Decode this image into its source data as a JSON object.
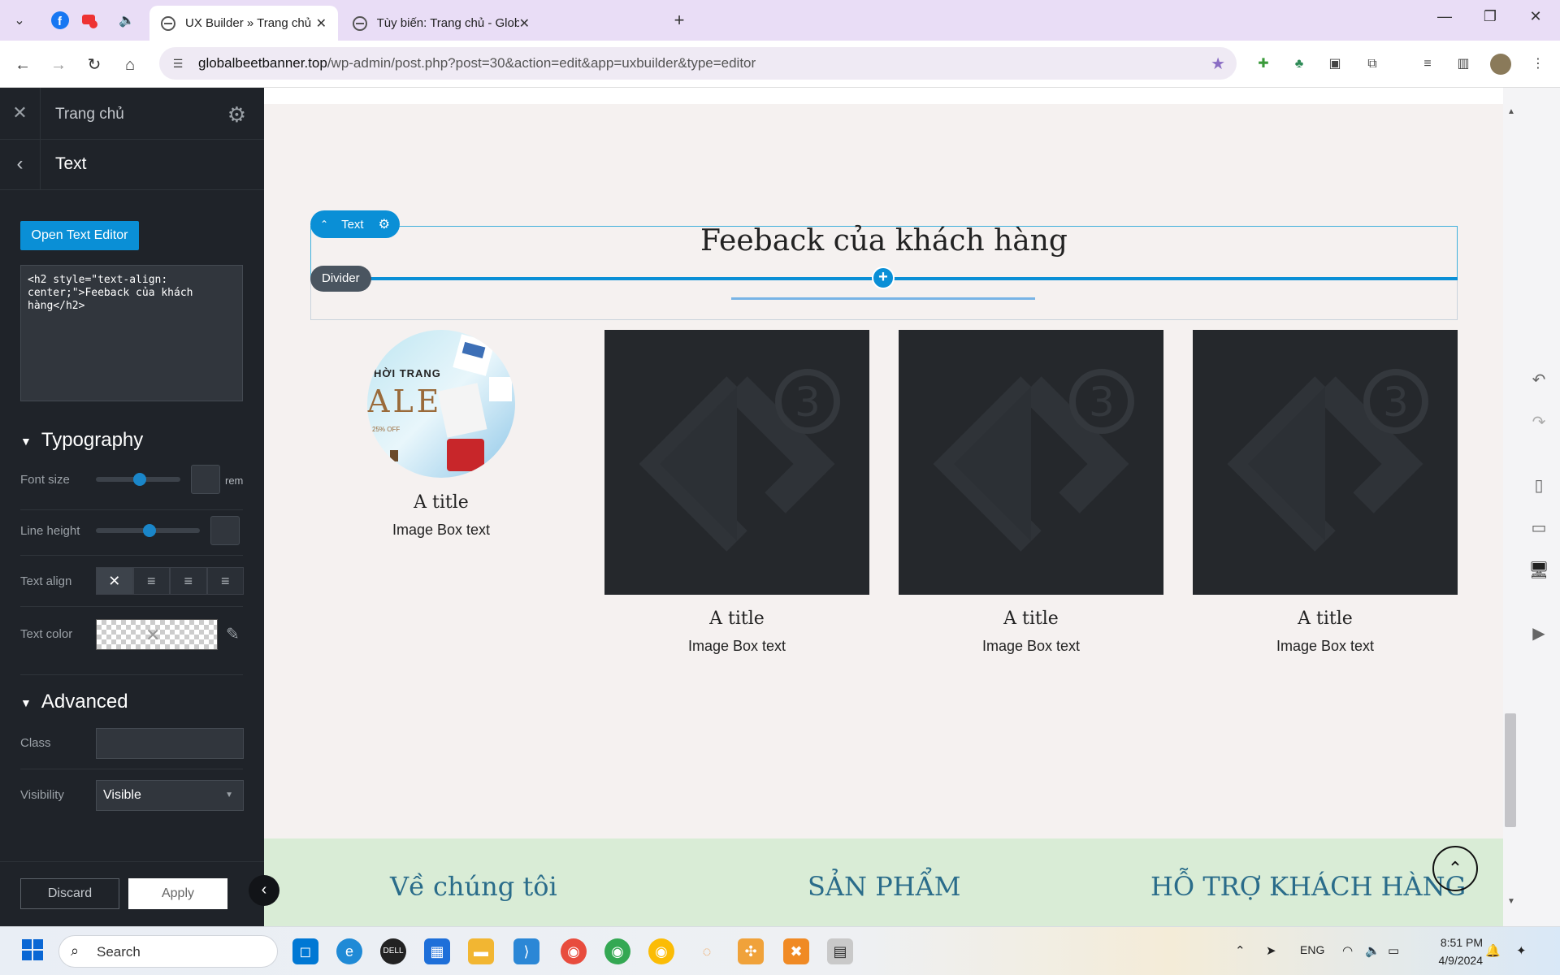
{
  "browser": {
    "tabs": [
      {
        "label": "UX Builder » Trang chủ",
        "active": true
      },
      {
        "label": "Tùy biến: Trang chủ - Global Be",
        "active": false
      }
    ],
    "url_host": "globalbeetbanner.top",
    "url_path": "/wp-admin/post.php?post=30&action=edit&app=uxbuilder&type=editor",
    "accent": "#8a6dc4"
  },
  "sidebar": {
    "page_title": "Trang chủ",
    "panel_title": "Text",
    "open_editor_label": "Open Text Editor",
    "html_source": "<h2 style=\"text-align:\ncenter;\">Feeback của khách\nhàng</h2>",
    "typography": {
      "heading": "Typography",
      "font_size_label": "Font size",
      "font_size_unit": "rem",
      "font_size_level": 0.5,
      "line_height_label": "Line height",
      "line_height_level": 0.5,
      "text_align_label": "Text align",
      "text_color_label": "Text color"
    },
    "advanced": {
      "heading": "Advanced",
      "class_label": "Class",
      "class_value": "",
      "visibility_label": "Visibility",
      "visibility_value": "Visible"
    },
    "discard_label": "Discard",
    "apply_label": "Apply",
    "accent": "#0a8fd6"
  },
  "canvas": {
    "heading": "Feeback của khách hàng",
    "text_tag": "Text",
    "divider_tag": "Divider",
    "round_image_lines": [
      "HỜI TRANG",
      "ALE",
      "25% OFF"
    ],
    "cards": [
      {
        "title": "A title",
        "text": "Image Box text"
      },
      {
        "title": "A title",
        "text": "Image Box text"
      },
      {
        "title": "A title",
        "text": "Image Box text"
      },
      {
        "title": "A title",
        "text": "Image Box text"
      }
    ],
    "footer": [
      "Về chúng tôi",
      "SẢN PHẨM",
      "HỖ TRỢ KHÁCH HÀNG"
    ]
  },
  "taskbar": {
    "search_label": "Search",
    "lang": "ENG",
    "time": "8:51 PM",
    "date": "4/9/2024"
  }
}
